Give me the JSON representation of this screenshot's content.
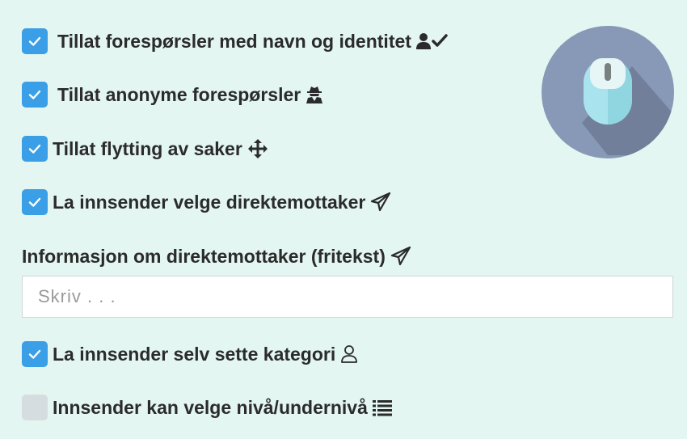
{
  "options": [
    {
      "label": "Tillat forespørsler med navn og identitet",
      "checked": true,
      "icon": "user-check-icon"
    },
    {
      "label": "Tillat anonyme forespørsler",
      "checked": true,
      "icon": "user-secret-icon"
    },
    {
      "label": "Tillat flytting av saker",
      "checked": true,
      "icon": "arrows-move-icon"
    },
    {
      "label": "La innsender velge direktemottaker",
      "checked": true,
      "icon": "paper-plane-icon"
    }
  ],
  "direct_recipient_info": {
    "label": "Informasjon om direktemottaker (fritekst)",
    "icon": "paper-plane-icon",
    "placeholder": "Skriv . . .",
    "value": ""
  },
  "options_lower": [
    {
      "label": "La innsender selv sette kategori",
      "checked": true,
      "icon": "user-outline-icon"
    },
    {
      "label": "Innsender kan velge nivå/undernivå",
      "checked": false,
      "icon": "list-icon"
    }
  ],
  "colors": {
    "background": "#e3f6f1",
    "checkbox_checked": "#3a9fe6",
    "checkbox_unchecked": "#d6dde0",
    "text": "#2b2b2b"
  },
  "hero_icon": "mouse-icon"
}
